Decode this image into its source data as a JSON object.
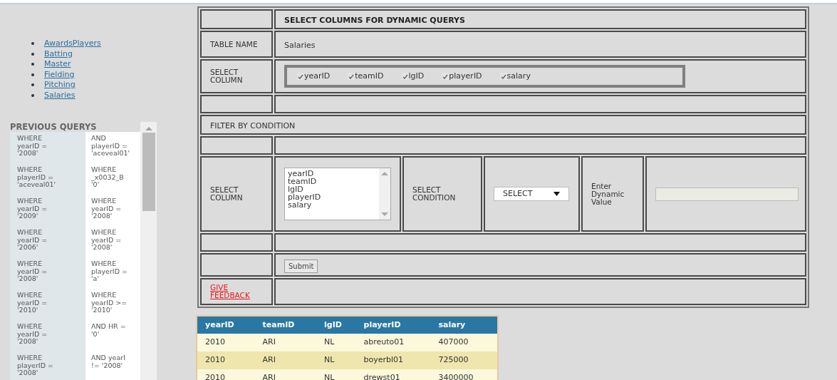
{
  "nav_links": [
    "AwardsPlayers",
    "Batting",
    "Master",
    "Fielding",
    "Pitching",
    "Salaries"
  ],
  "previous_queries": {
    "title": "PREVIOUS QUERYS",
    "rows": [
      {
        "left": "WHERE\nyearID =\n'2008'",
        "right": "AND\nplayerID =\n'aceveal01'"
      },
      {
        "left": "WHERE\nplayerID =\n'aceveal01'",
        "right": "WHERE\n_x0032_B\n'0'"
      },
      {
        "left": "WHERE\nyearID =\n'2009'",
        "right": "WHERE\nyearID =\n'2008'"
      },
      {
        "left": "WHERE\nyearID =\n'2006'",
        "right": "WHERE\nyearID =\n'2008'"
      },
      {
        "left": "WHERE\nyearID =\n'2008'",
        "right": "WHERE\nplayerID =\n'a'"
      },
      {
        "left": "WHERE\nyearID =\n'2010'",
        "right": "WHERE\nyearID >=\n'2010'"
      },
      {
        "left": "WHERE\nyearID =\n'2008'",
        "right": "AND HR =\n'0'"
      },
      {
        "left": "WHERE\nplayerID =\n'2008'",
        "right": "AND yearI\n!= '2008'"
      }
    ]
  },
  "form": {
    "title": "SELECT COLUMNS FOR DYNAMIC QUERYS",
    "table_name_label": "TABLE NAME",
    "table_name": "Salaries",
    "select_column_label": "SELECT COLUMN",
    "columns": [
      {
        "label": "yearID",
        "checked": true
      },
      {
        "label": "teamID",
        "checked": true
      },
      {
        "label": "lgID",
        "checked": true
      },
      {
        "label": "playerID",
        "checked": true
      },
      {
        "label": "salary",
        "checked": true
      }
    ],
    "filter_heading": "FILTER BY CONDITION",
    "filter_column_label": "SELECT COLUMN",
    "filter_column_options": [
      "yearID",
      "teamID",
      "lgID",
      "playerID",
      "salary"
    ],
    "condition_label": "SELECT CONDITION",
    "condition_select": "SELECT",
    "value_label": "Enter Dynamic Value",
    "submit": "Submit",
    "feedback_link": "GIVE FEEDBACK"
  },
  "results": {
    "columns": [
      "yearID",
      "teamID",
      "lgID",
      "playerID",
      "salary"
    ],
    "rows": [
      [
        "2010",
        "ARI",
        "NL",
        "abreuto01",
        "407000"
      ],
      [
        "2010",
        "ARI",
        "NL",
        "boyerbl01",
        "725000"
      ],
      [
        "2010",
        "ARI",
        "NL",
        "drewst01",
        "3400000"
      ]
    ]
  }
}
